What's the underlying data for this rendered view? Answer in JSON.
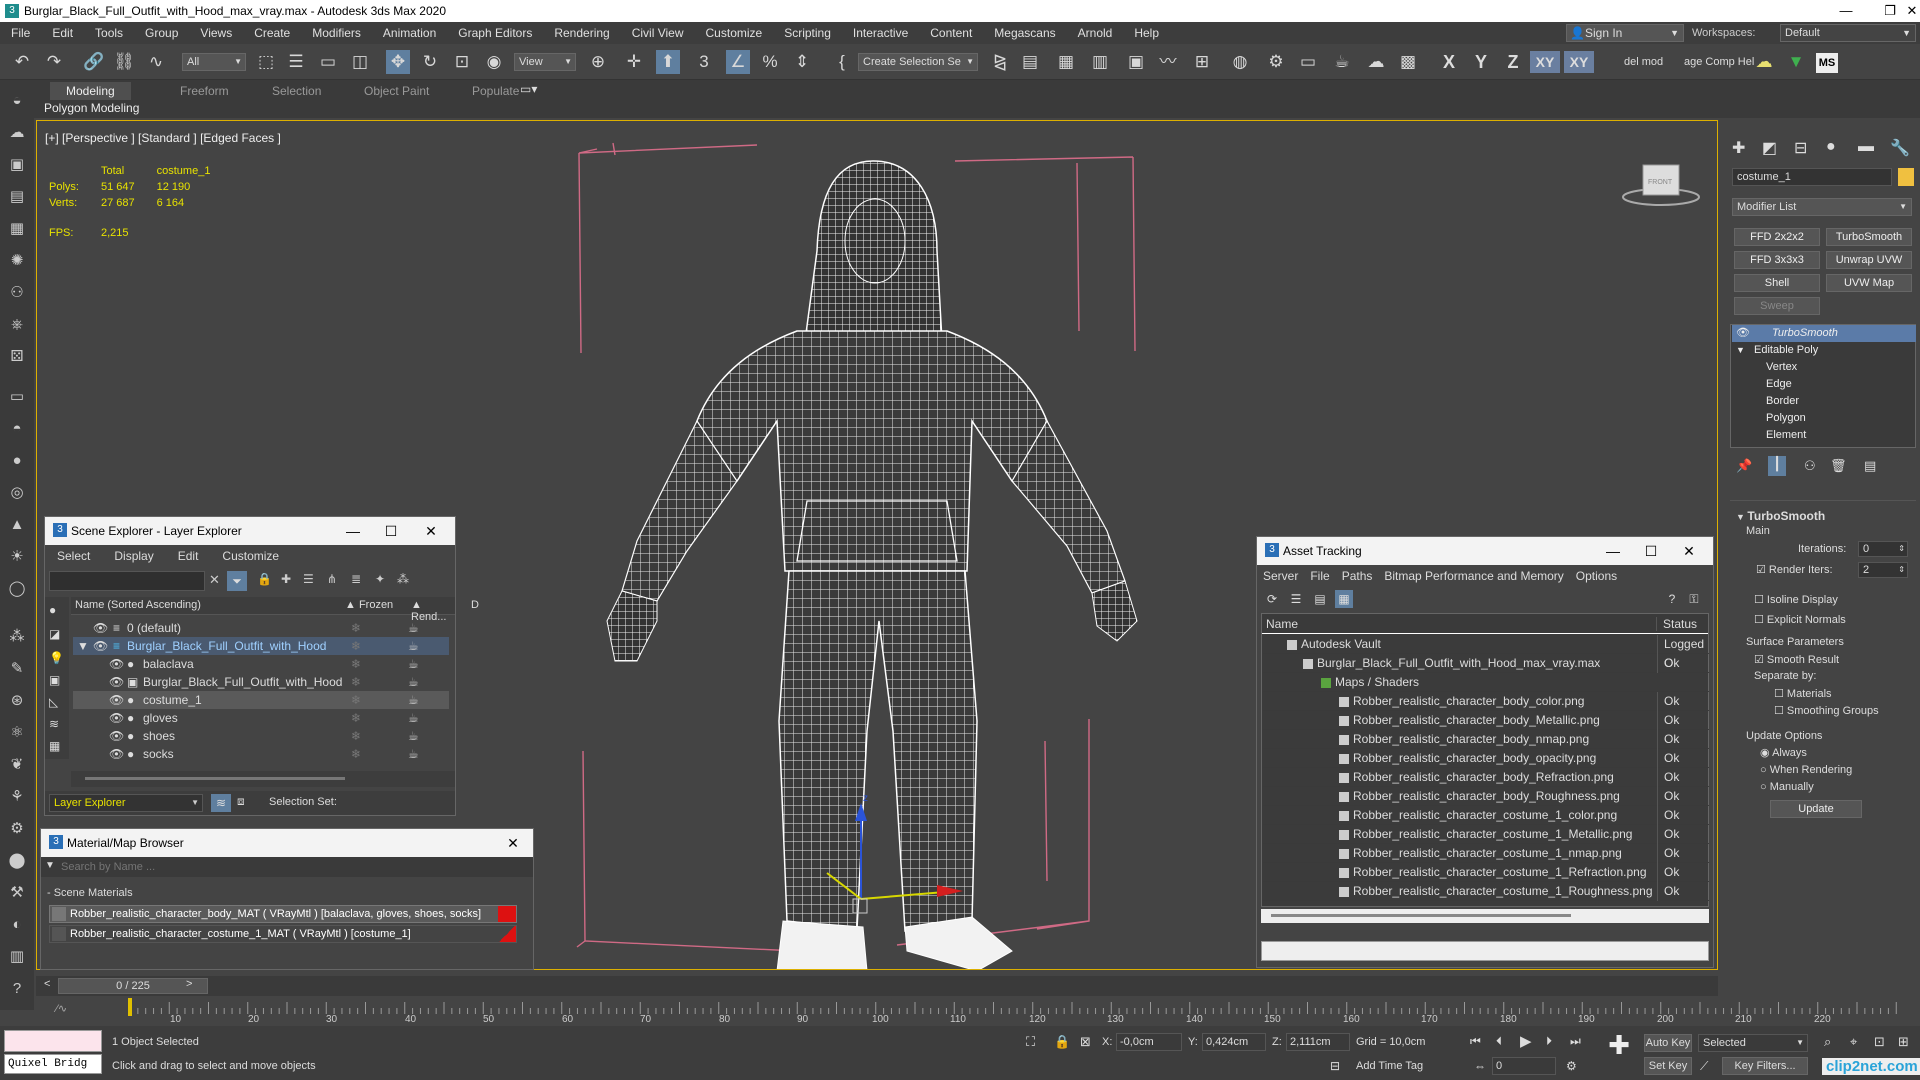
{
  "window": {
    "title": "Burglar_Black_Full_Outfit_with_Hood_max_vray.max - Autodesk 3ds Max 2020"
  },
  "menu": [
    "File",
    "Edit",
    "Tools",
    "Group",
    "Views",
    "Create",
    "Modifiers",
    "Animation",
    "Graph Editors",
    "Rendering",
    "Civil View",
    "Customize",
    "Scripting",
    "Interactive",
    "Content",
    "Megascans",
    "Arnold",
    "Help"
  ],
  "topright": {
    "sign_in": "Sign In",
    "workspaces_label": "Workspaces:",
    "workspace": "Default"
  },
  "toolbar": {
    "filter": "All",
    "refcoord": "View",
    "selection_set": "Create Selection Se",
    "axes": [
      "X",
      "Y",
      "Z",
      "XY",
      "XY"
    ],
    "right_labels": [
      "del mod",
      "age Comp Hel"
    ],
    "ms": "MS"
  },
  "ribbon": {
    "tabs": [
      "Modeling",
      "Freeform",
      "Selection",
      "Object Paint",
      "Populate"
    ],
    "sub": "Polygon Modeling"
  },
  "viewport": {
    "label": "[+] [Perspective ] [Standard ] [Edged Faces ]",
    "stats": {
      "h_total": "Total",
      "h_obj": "costume_1",
      "polys_label": "Polys:",
      "polys_total": "51 647",
      "polys_obj": "12 190",
      "verts_label": "Verts:",
      "verts_total": "27 687",
      "verts_obj": "6 164",
      "fps_label": "FPS:",
      "fps": "2,215"
    },
    "cube_label": "FRONT"
  },
  "scene_explorer": {
    "title": "Scene Explorer - Layer Explorer",
    "menu": [
      "Select",
      "Display",
      "Edit",
      "Customize"
    ],
    "columns": {
      "name": "Name (Sorted Ascending)",
      "frozen": "▲ Frozen",
      "render": "▲ Rend...",
      "d": "D"
    },
    "rows": [
      {
        "name": "0 (default)"
      },
      {
        "name": "Burglar_Black_Full_Outfit_with_Hood"
      },
      {
        "name": "balaclava"
      },
      {
        "name": "Burglar_Black_Full_Outfit_with_Hood"
      },
      {
        "name": "costume_1"
      },
      {
        "name": "gloves"
      },
      {
        "name": "shoes"
      },
      {
        "name": "socks"
      }
    ],
    "footer_mode": "Layer Explorer",
    "selection_set": "Selection Set:"
  },
  "material_browser": {
    "title": "Material/Map Browser",
    "search_placeholder": "Search by Name ...",
    "group": "- Scene Materials",
    "items": [
      "Robber_realistic_character_body_MAT ( VRayMtl ) [balaclava, gloves, shoes, socks]",
      "Robber_realistic_character_costume_1_MAT ( VRayMtl ) [costume_1]"
    ]
  },
  "asset_tracking": {
    "title": "Asset Tracking",
    "menu": [
      "Server",
      "File",
      "Paths",
      "Bitmap Performance and Memory",
      "Options"
    ],
    "columns": {
      "name": "Name",
      "status": "Status"
    },
    "rows": [
      {
        "name": "Autodesk Vault",
        "status": "Logged O"
      },
      {
        "name": "Burglar_Black_Full_Outfit_with_Hood_max_vray.max",
        "status": "Ok"
      },
      {
        "name": "Maps / Shaders",
        "status": ""
      },
      {
        "name": "Robber_realistic_character_body_color.png",
        "status": "Ok"
      },
      {
        "name": "Robber_realistic_character_body_Metallic.png",
        "status": "Ok"
      },
      {
        "name": "Robber_realistic_character_body_nmap.png",
        "status": "Ok"
      },
      {
        "name": "Robber_realistic_character_body_opacity.png",
        "status": "Ok"
      },
      {
        "name": "Robber_realistic_character_body_Refraction.png",
        "status": "Ok"
      },
      {
        "name": "Robber_realistic_character_body_Roughness.png",
        "status": "Ok"
      },
      {
        "name": "Robber_realistic_character_costume_1_color.png",
        "status": "Ok"
      },
      {
        "name": "Robber_realistic_character_costume_1_Metallic.png",
        "status": "Ok"
      },
      {
        "name": "Robber_realistic_character_costume_1_nmap.png",
        "status": "Ok"
      },
      {
        "name": "Robber_realistic_character_costume_1_Refraction.png",
        "status": "Ok"
      },
      {
        "name": "Robber_realistic_character_costume_1_Roughness.png",
        "status": "Ok"
      }
    ]
  },
  "command_panel": {
    "object_name": "costume_1",
    "modifier_list": "Modifier List",
    "buttons": [
      "FFD 2x2x2",
      "TurboSmooth",
      "FFD 3x3x3",
      "Unwrap UVW",
      "Shell",
      "UVW Map",
      "Sweep"
    ],
    "stack": [
      "TurboSmooth",
      "Editable Poly",
      "Vertex",
      "Edge",
      "Border",
      "Polygon",
      "Element"
    ],
    "rollout": {
      "title": "TurboSmooth",
      "main": "Main",
      "iterations_label": "Iterations:",
      "iterations": "0",
      "render_iters_label": "Render Iters:",
      "render_iters": "2",
      "isoline": "Isoline Display",
      "explicit": "Explicit Normals",
      "surface": "Surface Parameters",
      "smooth": "Smooth Result",
      "separate": "Separate by:",
      "materials": "Materials",
      "smoothing": "Smoothing Groups",
      "update_options": "Update Options",
      "always": "Always",
      "when_rendering": "When Rendering",
      "manually": "Manually",
      "update": "Update"
    }
  },
  "timeline": {
    "frame": "0 / 225",
    "ticks": [
      "10",
      "20",
      "30",
      "40",
      "50",
      "60",
      "70",
      "80",
      "90",
      "100",
      "110",
      "120",
      "130",
      "140",
      "150",
      "160",
      "170",
      "180",
      "190",
      "200",
      "210",
      "220"
    ]
  },
  "status": {
    "script_label": "Quixel Bridg",
    "selected": "1 Object Selected",
    "hint": "Click and drag to select and move objects",
    "x_label": "X:",
    "x": "-0,0cm",
    "y_label": "Y:",
    "y": "0,424cm",
    "z_label": "Z:",
    "z": "2,111cm",
    "grid": "Grid = 10,0cm",
    "add_time_tag": "Add Time Tag",
    "auto_key": "Auto Key",
    "selected_mode": "Selected",
    "set_key": "Set Key",
    "key_filters": "Key Filters...",
    "frame_field": "0",
    "watermark": "clip2net.com"
  }
}
